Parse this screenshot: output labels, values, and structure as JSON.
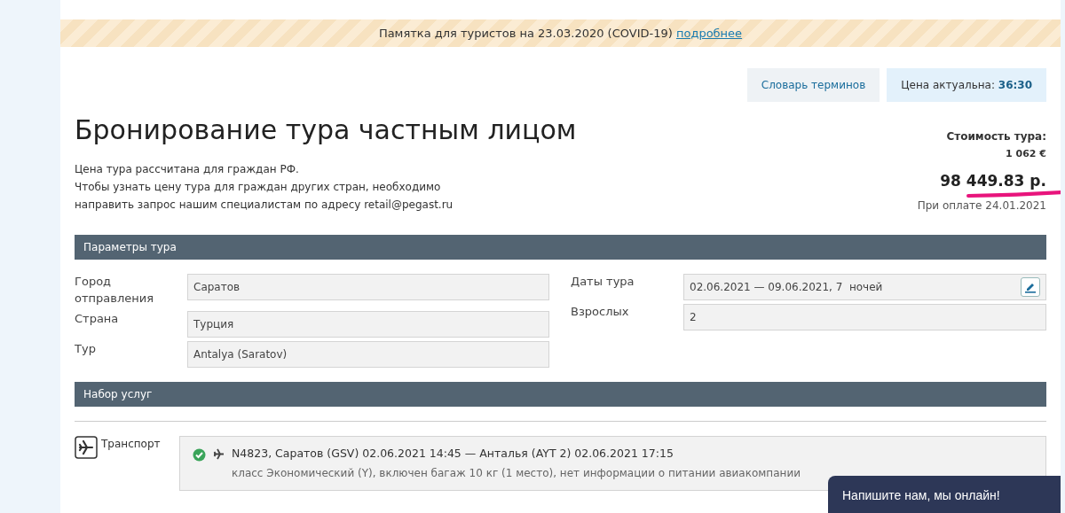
{
  "banner": {
    "text": "Памятка для туристов на 23.03.2020 (COVID-19)",
    "link": "подробнее"
  },
  "top_buttons": {
    "glossary": "Словарь терминов",
    "price_label": "Цена актуальна:",
    "price_timer": "36:30"
  },
  "title": "Бронирование тура частным лицом",
  "notes": [
    "Цена тура рассчитана для граждан РФ.",
    "Чтобы узнать цену тура для граждан других стран, необходимо",
    "направить запрос нашим специалистам по адресу retail@pegast.ru"
  ],
  "cost": {
    "label": "Стоимость тура:",
    "eur": "1 062 €",
    "rub": "98 449.83 р.",
    "note": "При оплате 24.01.2021"
  },
  "params": {
    "heading": "Параметры тура",
    "left": [
      {
        "label": "Город отправления",
        "value": "Саратов"
      },
      {
        "label": "Страна",
        "value": "Турция"
      },
      {
        "label": "Тур",
        "value": "Antalya (Saratov)"
      }
    ],
    "right": [
      {
        "label": "Даты тура",
        "value": "02.06.2021 — 09.06.2021, 7  ночей",
        "editable": true
      },
      {
        "label": "Взрослых",
        "value": "2",
        "editable": false
      }
    ]
  },
  "services": {
    "heading": "Набор услуг",
    "category": "Транспорт",
    "flight": {
      "confirmed": true,
      "line1": "N4823, Саратов (GSV) 02.06.2021 14:45 — Анталья (AYT 2) 02.06.2021 17:15",
      "line2": "класс Экономический (Y), включен багаж 10 кг (1 место), нет информации о питании авиакомпании"
    }
  },
  "chat": "Напишите нам, мы онлайн!"
}
